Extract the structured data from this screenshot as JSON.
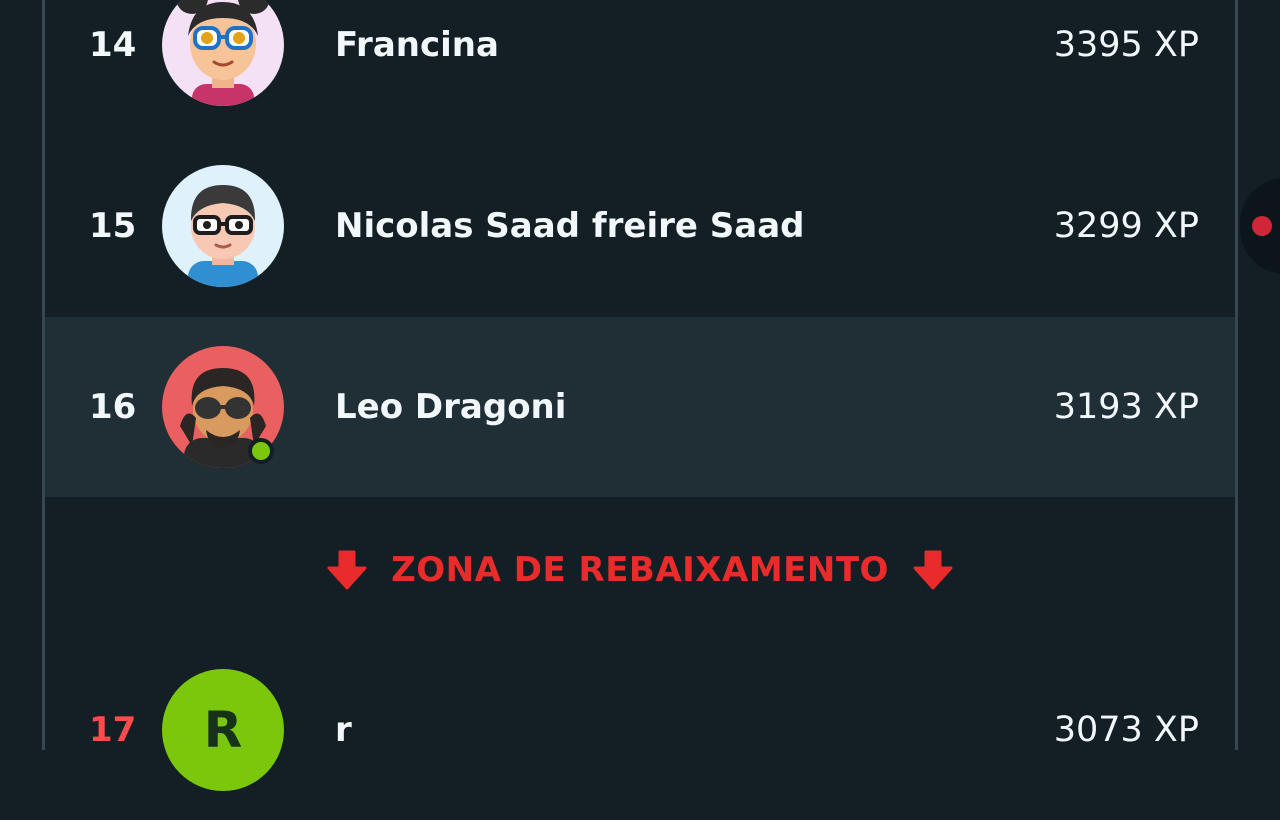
{
  "leaderboard": {
    "rows": [
      {
        "rank": "14",
        "name": "Francina",
        "xp": "3395 XP",
        "avatar_icon": "girl-with-glasses-avatar"
      },
      {
        "rank": "15",
        "name": "Nicolas Saad freire Saad",
        "xp": "3299 XP",
        "avatar_icon": "boy-with-glasses-avatar"
      },
      {
        "rank": "16",
        "name": "Leo Dragoni",
        "xp": "3193 XP",
        "avatar_icon": "man-with-sunglasses-avatar",
        "online": true,
        "highlighted": true
      }
    ],
    "demotion_zone_label": "ZONA DE REBAIXAMENTO",
    "partial_next_row": {
      "rank": "17",
      "initial": "R",
      "name": "r",
      "xp": "3073 XP"
    }
  },
  "colors": {
    "background": "#131f24",
    "highlight_row": "#202f36",
    "demotion_red": "#ea2b2b",
    "online_green": "#7ac70c"
  }
}
